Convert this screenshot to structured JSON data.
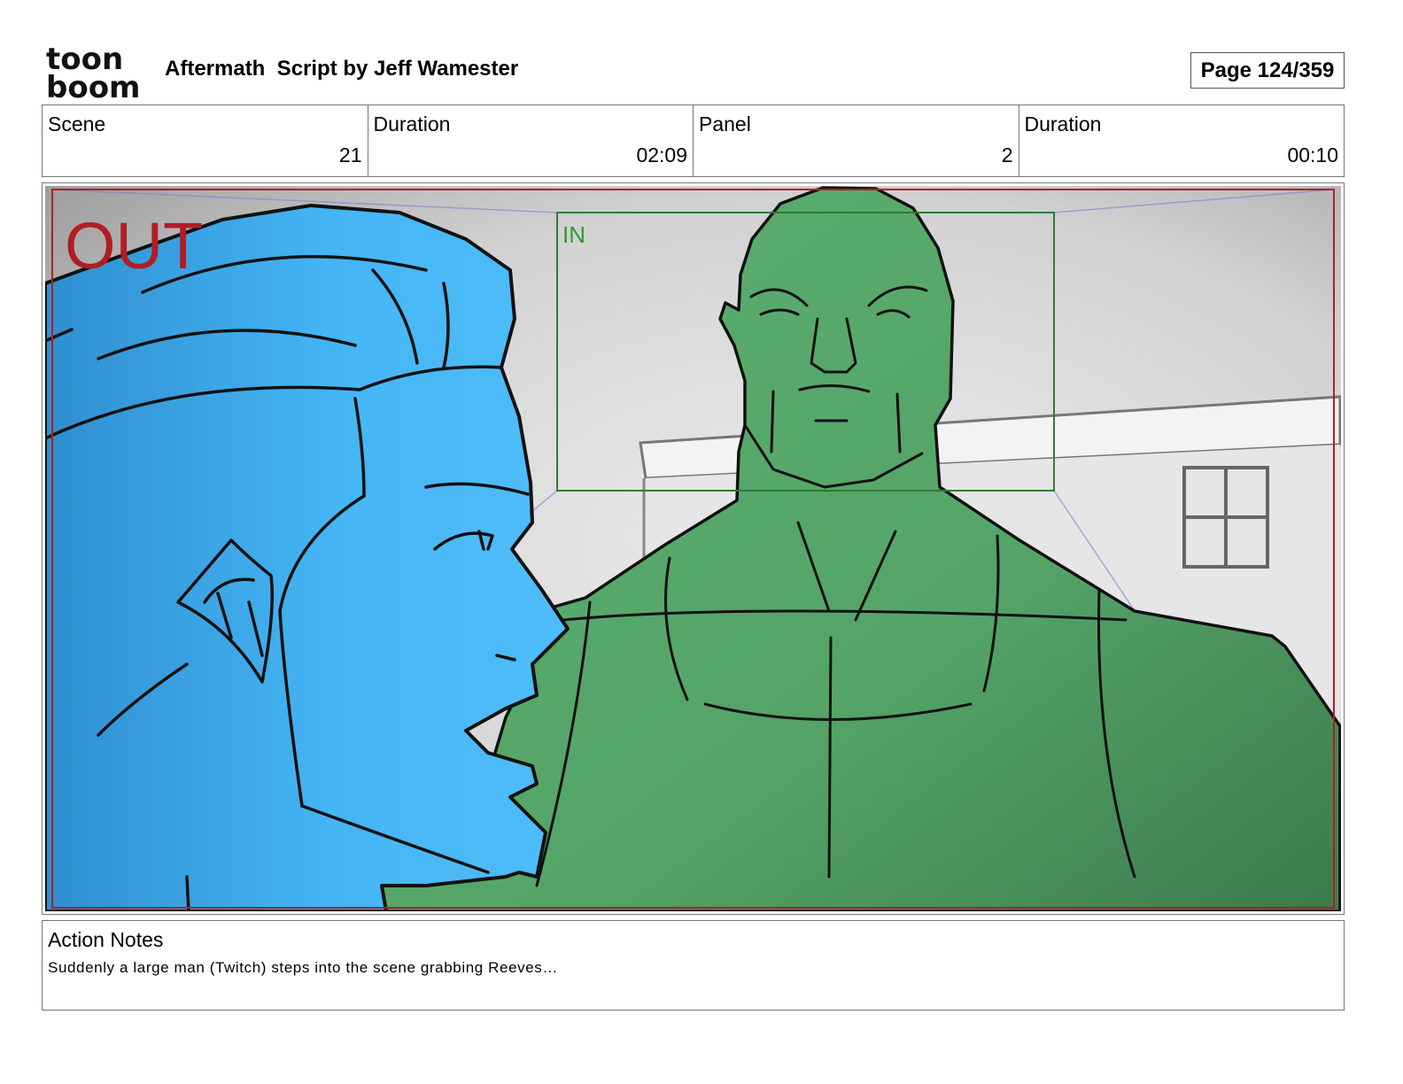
{
  "header": {
    "logo": {
      "line1": "toon",
      "line2": "boom"
    },
    "title": "Aftermath  Script by Jeff Wamester",
    "page": "Page 124/359"
  },
  "info": {
    "scene": {
      "label": "Scene",
      "value": "21"
    },
    "scene_duration": {
      "label": "Duration",
      "value": "02:09"
    },
    "panel": {
      "label": "Panel",
      "value": "2"
    },
    "panel_duration": {
      "label": "Duration",
      "value": "00:10"
    }
  },
  "artwork": {
    "out_label": "OUT",
    "in_label": "IN",
    "colors": {
      "out_frame": "#b01e24",
      "in_frame": "#2f7d32",
      "foreground_character": "#45b5f5",
      "background_character": "#58a86c",
      "background": "#d0d0d0"
    }
  },
  "notes": {
    "title": "Action Notes",
    "text": "Suddenly a large man (Twitch) steps into the scene grabbing Reeves…"
  }
}
